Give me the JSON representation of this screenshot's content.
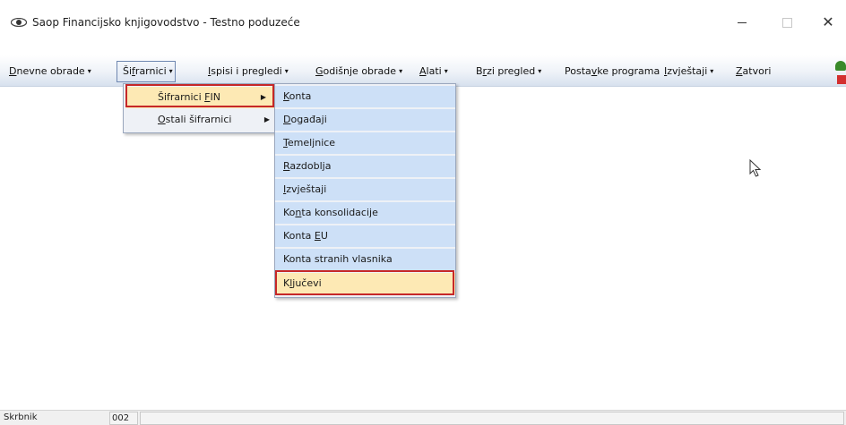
{
  "window": {
    "title": "Saop Financijsko knjigovodstvo - Testno poduzeće",
    "minimize_glyph": "—",
    "maximize_glyph": "□",
    "close_glyph": "✕"
  },
  "menubar": {
    "items": [
      {
        "pre": "",
        "ul": "D",
        "post": "nevne obrade",
        "dropdown": true
      },
      {
        "pre": "Ši",
        "ul": "f",
        "post": "rarnici",
        "dropdown": true
      },
      {
        "pre": "",
        "ul": "I",
        "post": "spisi i pregledi",
        "dropdown": true
      },
      {
        "pre": "",
        "ul": "G",
        "post": "odišnje obrade",
        "dropdown": true
      },
      {
        "pre": "",
        "ul": "A",
        "post": "lati",
        "dropdown": true
      },
      {
        "pre": "B",
        "ul": "r",
        "post": "zi pregled",
        "dropdown": true
      },
      {
        "pre": "Posta",
        "ul": "v",
        "post": "ke programa",
        "dropdown": false
      },
      {
        "pre": "",
        "ul": "I",
        "post": "zvještaji",
        "dropdown": true
      },
      {
        "pre": "",
        "ul": "Z",
        "post": "atvori",
        "dropdown": false
      }
    ],
    "caret": "▾"
  },
  "sifrarnici_menu": {
    "items": [
      {
        "pre": "Šifrarnici ",
        "ul": "F",
        "post": "IN",
        "submenu": true,
        "highlighted": true
      },
      {
        "pre": "",
        "ul": "O",
        "post": "stali šifrarnici",
        "submenu": true,
        "highlighted": false
      }
    ],
    "arrow": "▶"
  },
  "fin_submenu": {
    "items": [
      {
        "pre": "",
        "ul": "K",
        "post": "onta",
        "highlighted": false
      },
      {
        "pre": "",
        "ul": "D",
        "post": "ogađaji",
        "highlighted": false
      },
      {
        "pre": "",
        "ul": "T",
        "post": "emeljnice",
        "highlighted": false
      },
      {
        "pre": "",
        "ul": "R",
        "post": "azdoblja",
        "highlighted": false
      },
      {
        "pre": "",
        "ul": "I",
        "post": "zvještaji",
        "highlighted": false
      },
      {
        "pre": "Ko",
        "ul": "n",
        "post": "ta konsolidacije",
        "highlighted": false
      },
      {
        "pre": "Konta ",
        "ul": "E",
        "post": "U",
        "highlighted": false
      },
      {
        "pre": "Konta stranih vlasnika",
        "ul": "",
        "post": "",
        "highlighted": false
      },
      {
        "pre": "K",
        "ul": "l",
        "post": "jučevi",
        "highlighted": true
      }
    ]
  },
  "statusbar": {
    "user": "Skrbnik",
    "code": "002",
    "message": ""
  },
  "colors": {
    "highlight_blue": "#cde0f7",
    "highlight_gold": "#fde9b4",
    "annotation_red": "#c62828"
  },
  "icons": [
    "app-eye-icon",
    "mouse-pointer-icon",
    "submenu-arrow-icon",
    "dropdown-caret-icon"
  ]
}
